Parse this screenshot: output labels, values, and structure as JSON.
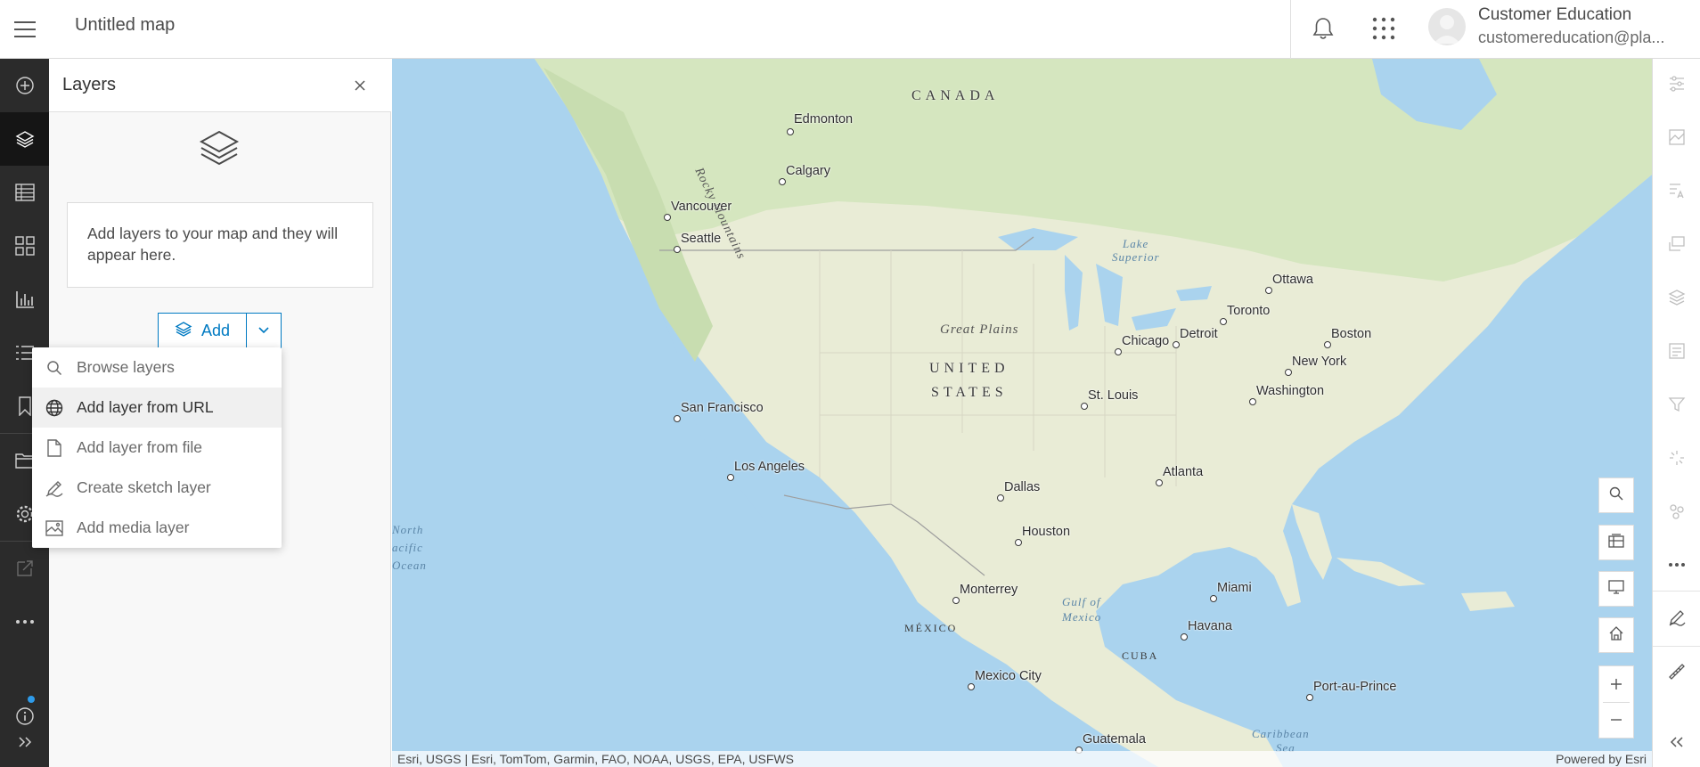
{
  "header": {
    "map_title": "Untitled map",
    "user_name": "Customer Education",
    "user_email": "customereducation@pla..."
  },
  "panel": {
    "title": "Layers",
    "empty_message": "Add layers to your map and they will appear here.",
    "add_label": "Add"
  },
  "add_menu": {
    "items": [
      {
        "label": "Browse layers",
        "icon": "search-icon"
      },
      {
        "label": "Add layer from URL",
        "icon": "globe-icon",
        "highlighted": true
      },
      {
        "label": "Add layer from file",
        "icon": "file-icon"
      },
      {
        "label": "Create sketch layer",
        "icon": "pencil-icon"
      },
      {
        "label": "Add media layer",
        "icon": "image-icon"
      }
    ]
  },
  "map": {
    "countries": {
      "canada": "CANADA",
      "united_states_line1": "UNITED",
      "united_states_line2": "STATES",
      "mexico": "MÉXICO",
      "cuba": "CUBA"
    },
    "regions": {
      "rocky_mountains": "Rocky Mountains",
      "great_plains": "Great Plains"
    },
    "water": {
      "lake_superior_1": "Lake",
      "lake_superior_2": "Superior",
      "north_pacific_1": "North",
      "north_pacific_2": "acific",
      "north_pacific_3": "Ocean",
      "gulf_1": "Gulf of",
      "gulf_2": "Mexico",
      "caribbean_1": "Caribbean",
      "caribbean_2": "Sea"
    },
    "cities": {
      "edmonton": "Edmonton",
      "calgary": "Calgary",
      "vancouver": "Vancouver",
      "seattle": "Seattle",
      "ottawa": "Ottawa",
      "toronto": "Toronto",
      "boston": "Boston",
      "new_york": "New York",
      "washington": "Washington",
      "chicago": "Chicago",
      "detroit": "Detroit",
      "st_louis": "St. Louis",
      "san_francisco": "San Francisco",
      "los_angeles": "Los Angeles",
      "dallas": "Dallas",
      "houston": "Houston",
      "atlanta": "Atlanta",
      "monterrey": "Monterrey",
      "miami": "Miami",
      "havana": "Havana",
      "mexico_city": "Mexico City",
      "port_au_prince": "Port-au-Prince",
      "guatemala": "Guatemala"
    },
    "attribution": "Esri, USGS | Esri, TomTom, Garmin, FAO, NOAA, USGS, EPA, USFWS",
    "powered_by": "Powered by Esri"
  },
  "colors": {
    "accent": "#007ac2",
    "action_bar": "#2b2b2b",
    "action_bar_active": "#151515",
    "water": "#aad3ee",
    "land": "#e9ecd6",
    "forest": "#cfe3b8",
    "info_dot": "#2e9bea"
  }
}
